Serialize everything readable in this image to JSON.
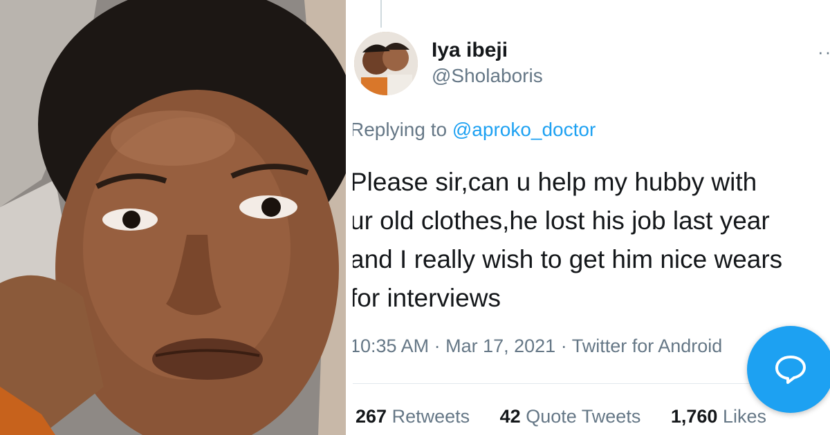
{
  "photo": {
    "icon": "selfie-photo"
  },
  "tweet": {
    "display_name": "Iya ibeji",
    "handle": "@Sholaboris",
    "more_icon": "ellipsis-icon",
    "replying_prefix": "Replying to ",
    "replying_to": "@aproko_doctor",
    "text": "Please sir,can u help my hubby with\nur old clothes,he lost his job last year\nand I really wish to get him nice wears\nfor interviews",
    "time": "10:35 AM",
    "date": "Mar 17, 2021",
    "source": "Twitter for Android",
    "separator": " · ",
    "stats": {
      "retweets_count": "267",
      "retweets_label": "Retweets",
      "quotes_count": "42",
      "quotes_label": "Quote Tweets",
      "likes_count": "1,760",
      "likes_label": "Likes"
    },
    "compose_icon": "speech-bubble-icon"
  },
  "colors": {
    "accent": "#1da1f2",
    "text_primary": "#14171a",
    "text_secondary": "#657786"
  }
}
